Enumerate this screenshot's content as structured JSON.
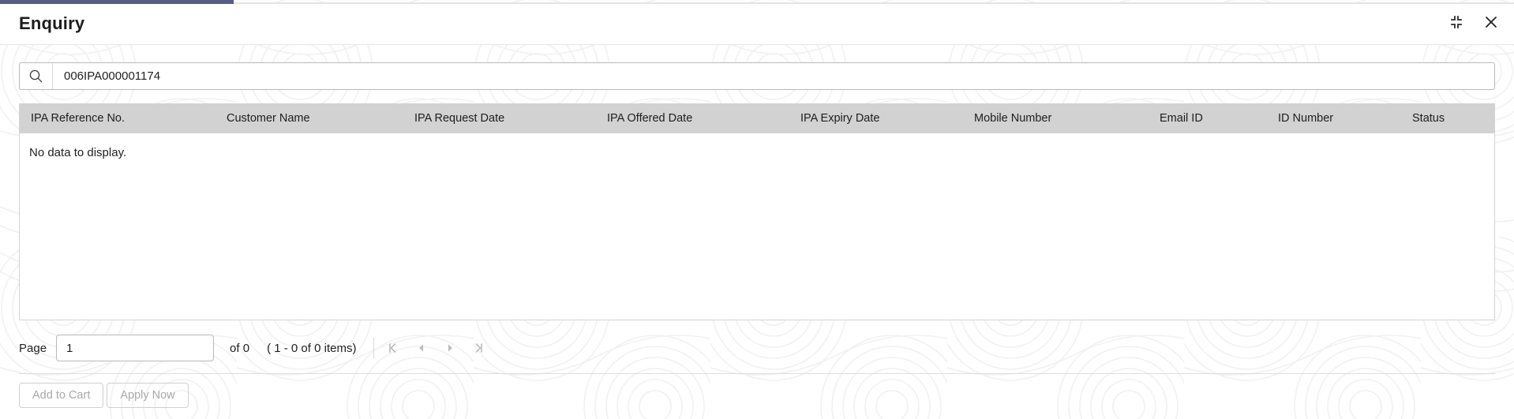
{
  "window": {
    "title": "Enquiry",
    "accent_color": "#575c80",
    "minimize_icon": "collapse-icon",
    "close_icon": "close-icon"
  },
  "search": {
    "icon": "search-icon",
    "value": "006IPA000001174",
    "placeholder": ""
  },
  "table": {
    "columns": [
      "IPA Reference No.",
      "Customer Name",
      "IPA Request Date",
      "IPA Offered Date",
      "IPA Expiry Date",
      "Mobile Number",
      "Email ID",
      "ID Number",
      "Status"
    ],
    "rows": [],
    "empty_message": "No data to display.",
    "header_bg": "#d2d2d2"
  },
  "pagination": {
    "page_label": "Page",
    "page_value": "1",
    "of_label": "of 0",
    "items_label": "( 1 - 0 of 0 items)",
    "first_icon": "first-page-icon",
    "prev_icon": "previous-page-icon",
    "next_icon": "next-page-icon",
    "last_icon": "last-page-icon"
  },
  "footer": {
    "add_to_cart_label": "Add to Cart",
    "apply_now_label": "Apply Now"
  }
}
